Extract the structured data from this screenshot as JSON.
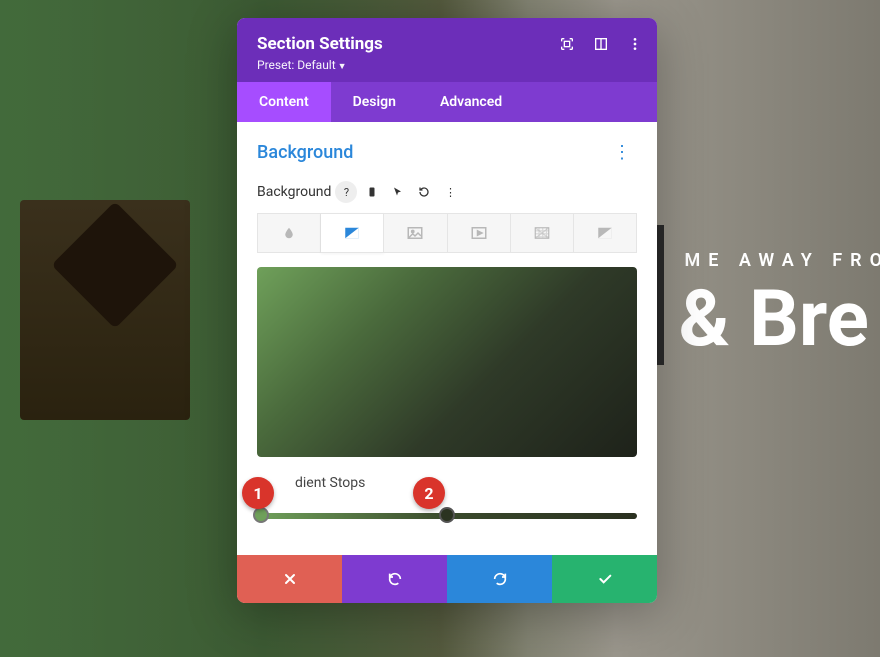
{
  "hero": {
    "subtitle": "ME AWAY FRO",
    "title": "& Bre"
  },
  "modal": {
    "title": "Section Settings",
    "preset_label": "Preset: Default"
  },
  "tabs": {
    "content": "Content",
    "design": "Design",
    "advanced": "Advanced"
  },
  "panel": {
    "section_title": "Background",
    "field_label": "Background",
    "stops_label": "dient Stops"
  },
  "annotations": {
    "a1": "1",
    "a2": "2"
  }
}
